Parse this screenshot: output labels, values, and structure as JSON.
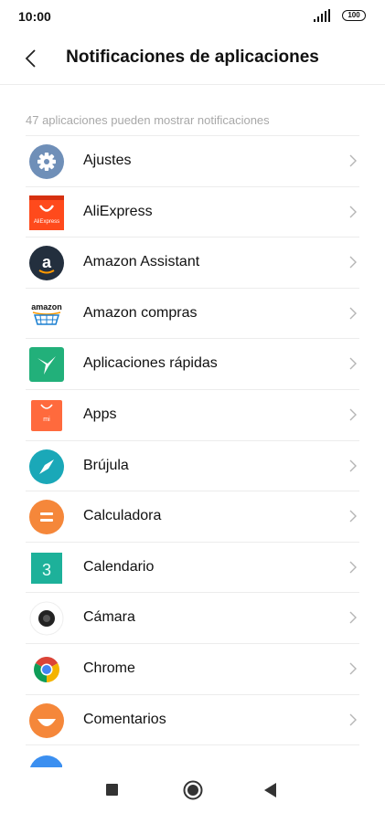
{
  "status_bar": {
    "time": "10:00",
    "battery": "100"
  },
  "header": {
    "title": "Notificaciones de aplicaciones",
    "back_icon": "chevron-left-icon"
  },
  "section_caption": "47 aplicaciones pueden mostrar notificaciones",
  "apps": [
    {
      "label": "Ajustes",
      "icon": "settings-gear-icon",
      "color": "#6f8fb8"
    },
    {
      "label": "AliExpress",
      "icon": "aliexpress-icon",
      "color": "#ff4a1c"
    },
    {
      "label": "Amazon Assistant",
      "icon": "amazon-assistant-icon",
      "color": "#232f3e"
    },
    {
      "label": "Amazon compras",
      "icon": "amazon-shopping-icon",
      "color": "#ffffff"
    },
    {
      "label": "Aplicaciones rápidas",
      "icon": "quick-apps-icon",
      "color": "#22b07a"
    },
    {
      "label": "Apps",
      "icon": "mi-apps-icon",
      "color": "#ff6a3d"
    },
    {
      "label": "Brújula",
      "icon": "compass-icon",
      "color": "#1aa8b8"
    },
    {
      "label": "Calculadora",
      "icon": "calculator-icon",
      "color": "#f5873a"
    },
    {
      "label": "Calendario",
      "icon": "calendar-icon",
      "color": "#1db19a"
    },
    {
      "label": "Cámara",
      "icon": "camera-icon",
      "color": "#222222"
    },
    {
      "label": "Chrome",
      "icon": "chrome-icon",
      "color": "#4285f4"
    },
    {
      "label": "Comentarios",
      "icon": "feedback-icon",
      "color": "#f5873a"
    }
  ],
  "calendar_day": "3",
  "aliexpress_text": "AliExpress",
  "amazon_text": "amazon",
  "amazon_assistant_letter": "a",
  "mi_text": "mi",
  "nav": {
    "recents_icon": "square-icon",
    "home_icon": "circle-icon",
    "back_icon": "triangle-back-icon"
  }
}
